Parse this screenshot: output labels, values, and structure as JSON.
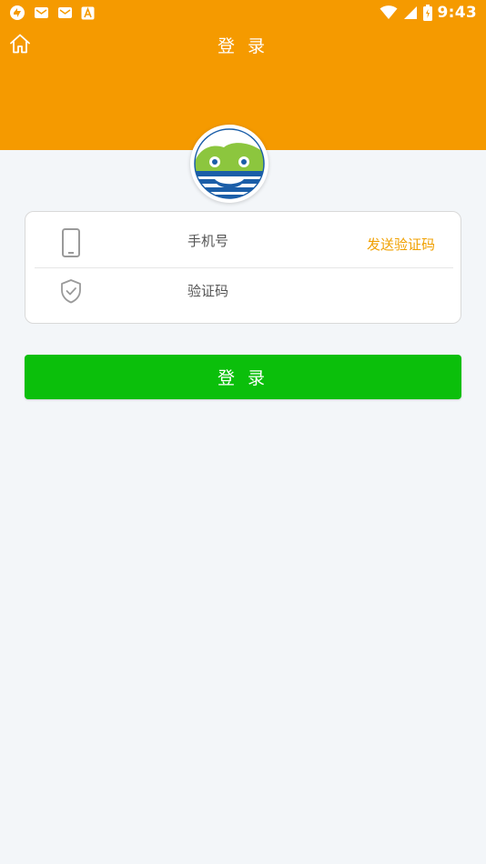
{
  "status_bar": {
    "time": "9:43",
    "left_icons": [
      "sync-icon",
      "mail-icon",
      "mail-icon",
      "font-app-icon"
    ],
    "right_icons": [
      "wifi-icon",
      "cell-signal-icon",
      "battery-icon"
    ]
  },
  "header": {
    "title": "登 录",
    "home_icon": "home-icon",
    "background": "#f59a00"
  },
  "form": {
    "phone": {
      "icon": "phone-icon",
      "placeholder": "手机号",
      "value": ""
    },
    "send_code_label": "发送验证码",
    "code": {
      "icon": "shield-check-icon",
      "placeholder": "验证码",
      "value": ""
    }
  },
  "login_button": {
    "label": "登 录",
    "color": "#0bbf0b"
  },
  "colors": {
    "accent": "#f59a00",
    "link": "#f0a000",
    "background": "#f3f6f9"
  }
}
